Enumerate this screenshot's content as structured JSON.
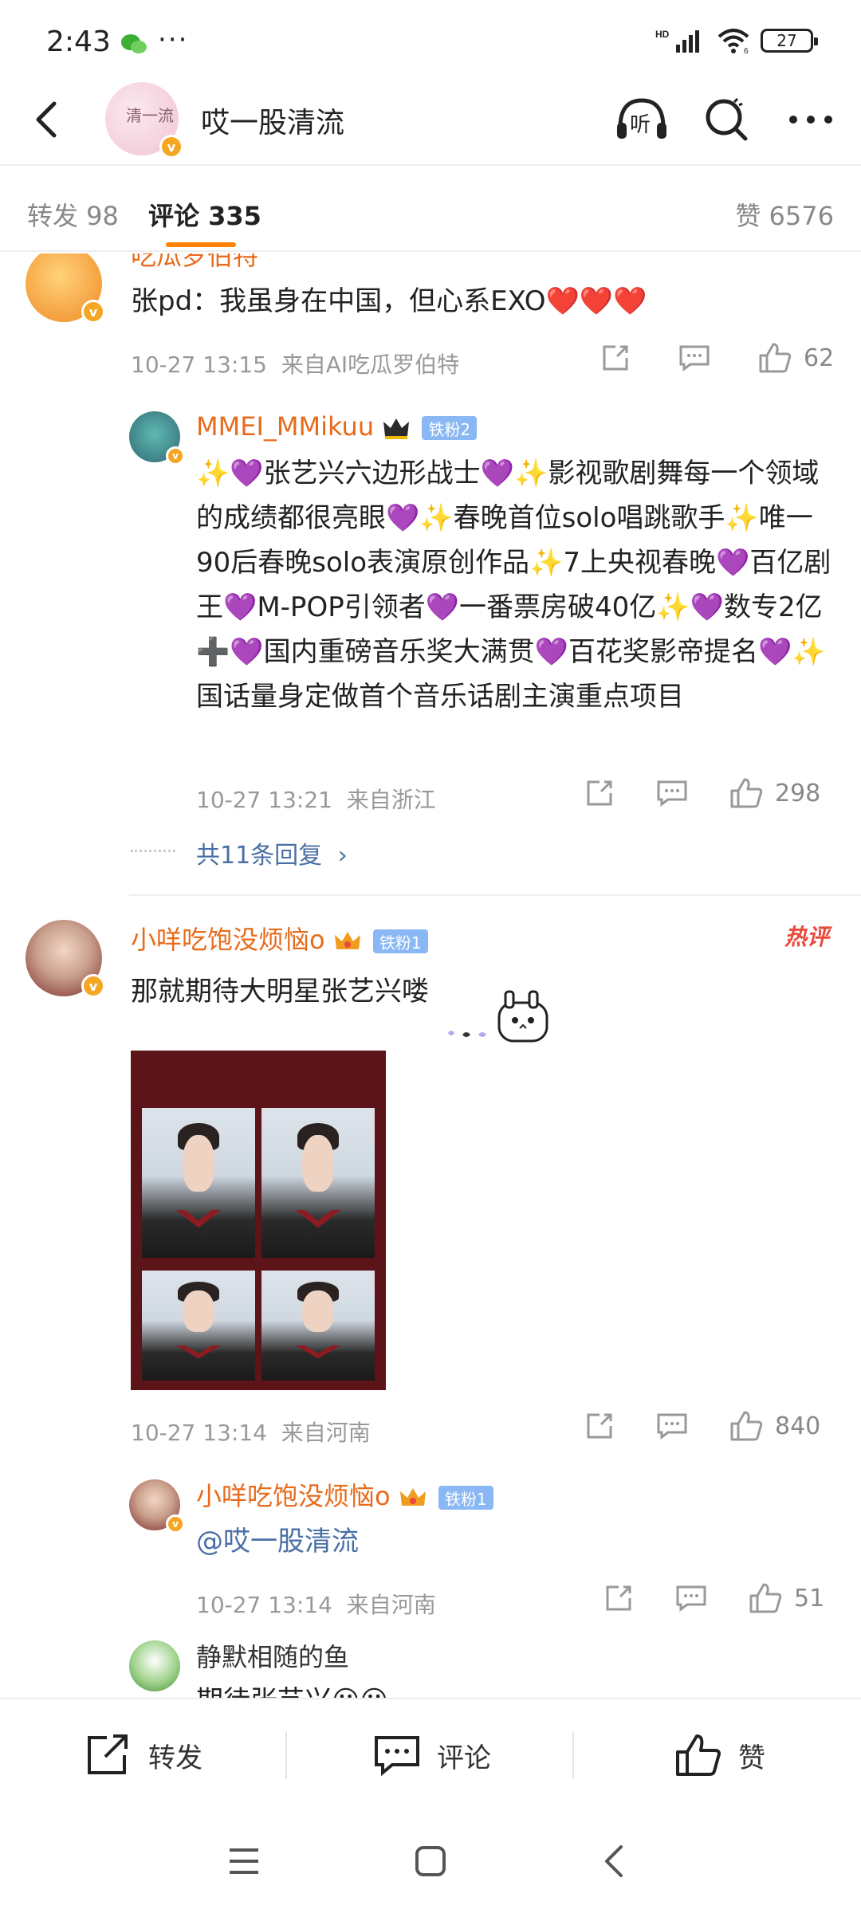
{
  "status": {
    "time": "2:43",
    "dots": "···",
    "network": "HD",
    "wifi_level": "6",
    "battery": "27"
  },
  "header": {
    "avatar_text": "清一流",
    "title": "哎一股清流",
    "listen_label": "听"
  },
  "tabs": {
    "repost": "转发 98",
    "comments": "评论 335",
    "likes": "赞 6576"
  },
  "comments": [
    {
      "user": "吃瓜罗伯特",
      "text": "张pd：我虽身在中国，但心系EXO❤️❤️❤️",
      "time": "10-27 13:15",
      "source": "来自AI吃瓜罗伯特",
      "likes": "62",
      "reply": {
        "user": "MMEI_MMikuu",
        "badge": "铁粉2",
        "text": "✨💜张艺兴六边形战士💜✨影视歌剧舞每一个领域的成绩都很亮眼💜✨春晚首位solo唱跳歌手✨唯一90后春晚solo表演原创作品✨7上央视春晚💜百亿剧王💜M-POP引领者💜一番票房破40亿✨💜数专2亿➕💜国内重磅音乐奖大满贯💜百花奖影帝提名💜✨国话量身定做首个音乐话剧主演重点项目",
        "time": "10-27 13:21",
        "source": "来自浙江",
        "likes": "298"
      },
      "more_replies": "共11条回复"
    },
    {
      "user": "小咩吃饱没烦恼o",
      "badge": "铁粉1",
      "hot": "热评",
      "text": "那就期待大明星张艺兴喽",
      "time": "10-27 13:14",
      "source": "来自河南",
      "likes": "840",
      "replies": [
        {
          "user": "小咩吃饱没烦恼o",
          "badge": "铁粉1",
          "text": "@哎一股清流",
          "time": "10-27 13:14",
          "source": "来自河南",
          "likes": "51"
        },
        {
          "user": "静默相随的鱼",
          "text": "期待张艺兴😀😀"
        }
      ]
    }
  ],
  "bottom": {
    "repost": "转发",
    "comment": "评论",
    "like": "赞"
  },
  "colors": {
    "accent": "#ff8200",
    "username": "#e86b1b",
    "link": "#4a6fa5",
    "hot": "#e84a3d"
  }
}
